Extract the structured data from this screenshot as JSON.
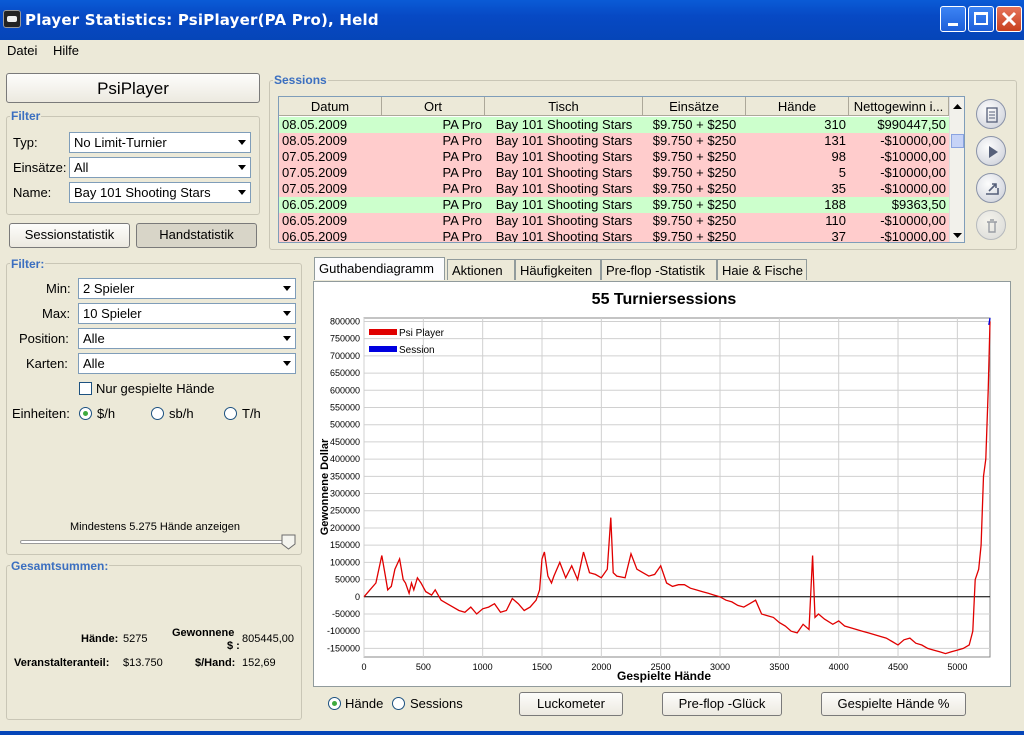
{
  "window": {
    "title": "Player Statistics: PsiPlayer(PA Pro), Held"
  },
  "menu": [
    "Datei",
    "Hilfe"
  ],
  "player": {
    "name": "PsiPlayer"
  },
  "filter_top": {
    "title": "Filter",
    "typ_label": "Typ:",
    "typ_value": "No Limit-Turnier",
    "einsaetze_label": "Einsätze:",
    "einsaetze_value": "All",
    "name_label": "Name:",
    "name_value": "Bay 101 Shooting Stars"
  },
  "toggle_buttons": {
    "sessions": "Sessionstatistik",
    "hands": "Handstatistik"
  },
  "filter_bottom": {
    "title": "Filter:",
    "min_label": "Min:",
    "min_value": "2 Spieler",
    "max_label": "Max:",
    "max_value": "10 Spieler",
    "position_label": "Position:",
    "position_value": "Alle",
    "karten_label": "Karten:",
    "karten_value": "Alle",
    "only_played_label": "Nur gespielte Hände",
    "einheiten_label": "Einheiten:",
    "units": [
      "$/h",
      "sb/h",
      "T/h"
    ],
    "selected_unit": 0,
    "slider_label": "Mindestens 5.275 Hände anzeigen"
  },
  "totals": {
    "title": "Gesamtsummen:",
    "haende_label": "Hände:",
    "haende_value": "5275",
    "gewonnene_label_1": "Gewonnene",
    "gewonnene_label_2": "$ :",
    "gewonnene_value": "805445,00",
    "veranstalter_label": "Veranstalteranteil:",
    "veranstalter_value": "$13.750",
    "per_hand_label": "$/Hand:",
    "per_hand_value": "152,69"
  },
  "sessions": {
    "title": "Sessions",
    "columns": [
      "Datum",
      "Ort",
      "Tisch",
      "Einsätze",
      "Hände",
      "Nettogewinn i..."
    ],
    "rows": [
      {
        "date": "08.05.2009",
        "ort": "PA Pro",
        "tisch": "Bay 101 Shooting Stars",
        "einsaetze": "$9.750 + $250",
        "haende": "310",
        "netto": "$990447,50",
        "status": "win"
      },
      {
        "date": "08.05.2009",
        "ort": "PA Pro",
        "tisch": "Bay 101 Shooting Stars",
        "einsaetze": "$9.750 + $250",
        "haende": "131",
        "netto": "-$10000,00",
        "status": "loss"
      },
      {
        "date": "07.05.2009",
        "ort": "PA Pro",
        "tisch": "Bay 101 Shooting Stars",
        "einsaetze": "$9.750 + $250",
        "haende": "98",
        "netto": "-$10000,00",
        "status": "loss"
      },
      {
        "date": "07.05.2009",
        "ort": "PA Pro",
        "tisch": "Bay 101 Shooting Stars",
        "einsaetze": "$9.750 + $250",
        "haende": "5",
        "netto": "-$10000,00",
        "status": "loss"
      },
      {
        "date": "07.05.2009",
        "ort": "PA Pro",
        "tisch": "Bay 101 Shooting Stars",
        "einsaetze": "$9.750 + $250",
        "haende": "35",
        "netto": "-$10000,00",
        "status": "loss"
      },
      {
        "date": "06.05.2009",
        "ort": "PA Pro",
        "tisch": "Bay 101 Shooting Stars",
        "einsaetze": "$9.750 + $250",
        "haende": "188",
        "netto": "$9363,50",
        "status": "win"
      },
      {
        "date": "06.05.2009",
        "ort": "PA Pro",
        "tisch": "Bay 101 Shooting Stars",
        "einsaetze": "$9.750 + $250",
        "haende": "110",
        "netto": "-$10000,00",
        "status": "loss"
      },
      {
        "date": "06.05.2009",
        "ort": "PA Pro",
        "tisch": "Bay 101 Shooting Stars",
        "einsaetze": "$9.750 + $250",
        "haende": "37",
        "netto": "-$10000,00",
        "status": "loss"
      }
    ]
  },
  "side_icons": [
    "list-icon",
    "play-icon",
    "export-icon",
    "trash-icon"
  ],
  "tabs": [
    "Guthabendiagramm",
    "Aktionen",
    "Häufigkeiten",
    "Pre-flop -Statistik",
    "Haie & Fische"
  ],
  "active_tab": 0,
  "bottom_bar": {
    "radio_hands": "Hände",
    "radio_sessions": "Sessions",
    "luck_button": "Luckometer",
    "preflop_button": "Pre-flop -Glück",
    "played_button": "Gespielte Hände %"
  },
  "colors": {
    "accent": "#3b6fc0",
    "win_row": "#ccffcc",
    "loss_row": "#ffcccc",
    "psiplayer_line": "#e00000",
    "session_line": "#0000e0"
  },
  "chart_data": {
    "type": "line",
    "title": "55 Turniersessions",
    "xlabel": "Gespielte Hände",
    "ylabel": "Gewonnene Dollar",
    "xlim": [
      0,
      5275
    ],
    "ylim": [
      -175000,
      810000
    ],
    "xticks": [
      0,
      500,
      1000,
      1500,
      2000,
      2500,
      3000,
      3500,
      4000,
      4500,
      5000
    ],
    "yticks": [
      -150000,
      -100000,
      -50000,
      0,
      50000,
      100000,
      150000,
      200000,
      250000,
      300000,
      350000,
      400000,
      450000,
      500000,
      550000,
      600000,
      650000,
      700000,
      750000,
      800000
    ],
    "legend": [
      "Psi Player",
      "Session"
    ],
    "legend_position": "top-left",
    "grid": true,
    "series": [
      {
        "name": "Psi Player",
        "color": "#e00000",
        "x": [
          0,
          50,
          100,
          150,
          180,
          200,
          230,
          260,
          300,
          330,
          350,
          380,
          400,
          420,
          450,
          480,
          520,
          570,
          600,
          650,
          700,
          750,
          800,
          850,
          900,
          950,
          1000,
          1050,
          1100,
          1150,
          1200,
          1250,
          1300,
          1350,
          1400,
          1450,
          1480,
          1500,
          1520,
          1550,
          1580,
          1600,
          1650,
          1700,
          1750,
          1800,
          1850,
          1900,
          1950,
          2000,
          2050,
          2080,
          2100,
          2130,
          2200,
          2250,
          2300,
          2350,
          2400,
          2450,
          2500,
          2550,
          2600,
          2650,
          2700,
          2750,
          2800,
          2850,
          2900,
          2950,
          3000,
          3050,
          3100,
          3150,
          3200,
          3250,
          3300,
          3350,
          3400,
          3450,
          3500,
          3550,
          3600,
          3650,
          3700,
          3750,
          3780,
          3800,
          3830,
          3880,
          3950,
          4000,
          4050,
          4100,
          4150,
          4200,
          4250,
          4300,
          4350,
          4400,
          4450,
          4500,
          4550,
          4600,
          4650,
          4700,
          4750,
          4800,
          4850,
          4900,
          4950,
          5000,
          5050,
          5100,
          5130,
          5150,
          5180,
          5200,
          5220,
          5240,
          5260,
          5275
        ],
        "y": [
          0,
          20000,
          40000,
          120000,
          60000,
          20000,
          30000,
          80000,
          110000,
          50000,
          40000,
          10000,
          40000,
          20000,
          55000,
          40000,
          15000,
          5000,
          20000,
          -10000,
          -20000,
          -30000,
          -40000,
          -45000,
          -30000,
          -50000,
          -35000,
          -30000,
          -20000,
          -45000,
          -40000,
          -5000,
          -20000,
          -40000,
          -30000,
          -10000,
          20000,
          110000,
          130000,
          60000,
          40000,
          60000,
          100000,
          55000,
          90000,
          50000,
          130000,
          70000,
          65000,
          55000,
          80000,
          230000,
          70000,
          60000,
          55000,
          125000,
          80000,
          70000,
          60000,
          65000,
          90000,
          40000,
          30000,
          35000,
          35000,
          25000,
          20000,
          15000,
          10000,
          5000,
          0,
          -10000,
          -15000,
          -25000,
          -30000,
          -20000,
          -10000,
          -50000,
          -55000,
          -60000,
          -75000,
          -85000,
          -100000,
          -105000,
          -80000,
          -95000,
          120000,
          -60000,
          -50000,
          -65000,
          -80000,
          -70000,
          -85000,
          -90000,
          -95000,
          -100000,
          -105000,
          -110000,
          -115000,
          -120000,
          -130000,
          -140000,
          -125000,
          -120000,
          -135000,
          -140000,
          -150000,
          -155000,
          -160000,
          -165000,
          -160000,
          -155000,
          -150000,
          -140000,
          -100000,
          50000,
          80000,
          150000,
          350000,
          400000,
          600000,
          800000
        ]
      },
      {
        "name": "Session",
        "color": "#0000e0",
        "x": [
          5265,
          5275
        ],
        "y": [
          790000,
          810000
        ]
      }
    ]
  }
}
